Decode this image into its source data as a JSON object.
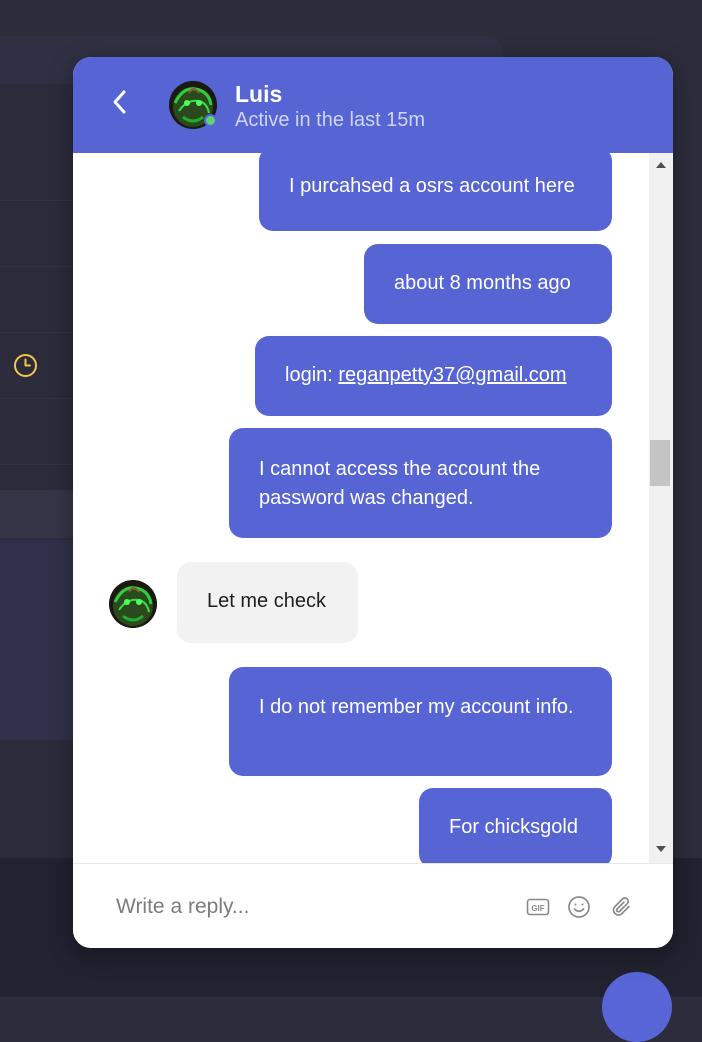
{
  "contact": {
    "name": "Luis",
    "status": "Active in the last 15m"
  },
  "messages": [
    {
      "sender": "me",
      "text": "I purcahsed a osrs account here"
    },
    {
      "sender": "me",
      "text": "about 8 months ago"
    },
    {
      "sender": "me",
      "prefix": "login: ",
      "link": "reganpetty37@gmail.com"
    },
    {
      "sender": "me",
      "text": "I cannot access the account the password was changed."
    },
    {
      "sender": "Luis",
      "text": "Let me check"
    },
    {
      "sender": "me",
      "text": "I do not remember my account info."
    },
    {
      "sender": "me",
      "text": "For chicksgold"
    }
  ],
  "composer": {
    "placeholder": "Write a reply..."
  },
  "icons": {
    "back": "chevron-left-icon",
    "gif": "gif-icon",
    "emoji": "emoji-icon",
    "attach": "paperclip-icon",
    "clock": "clock-icon"
  },
  "colors": {
    "accent": "#5664d4",
    "incoming_bubble": "#f2f2f2",
    "online": "#5fd17a",
    "background": "#2c2c3c",
    "clock": "#f0c84c"
  }
}
